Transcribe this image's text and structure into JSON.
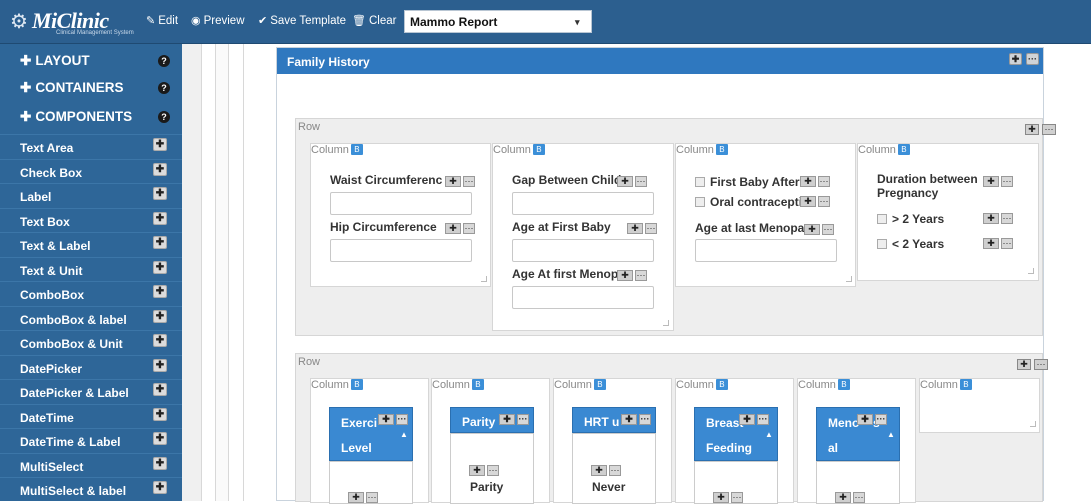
{
  "toolbar": {
    "brand": "MiClinic",
    "tagline": "Clinical Management System",
    "edit_label": "Edit",
    "preview_label": "Preview",
    "save_label": "Save Template",
    "clear_label": "Clear",
    "template_value": "Mammo Report",
    "template_arrow": "▾"
  },
  "sidebar": {
    "sections": [
      {
        "label": "LAYOUT",
        "help": "?"
      },
      {
        "label": "CONTAINERS",
        "help": "?"
      },
      {
        "label": "COMPONENTS",
        "help": "?"
      }
    ],
    "items": [
      "Text Area",
      "Check Box",
      "Label",
      "Text Box",
      "Text & Label",
      "Text & Unit",
      "ComboBox",
      "ComboBox & label",
      "ComboBox & Unit",
      "DatePicker",
      "DatePicker & Label",
      "DateTime",
      "DateTime & Label",
      "MultiSelect",
      "MultiSelect & label"
    ]
  },
  "panel": {
    "title": "Family History"
  },
  "row_label": "Row",
  "column_label": "Column",
  "row1": {
    "col1": {
      "f1": "Waist Circumferenc",
      "f2": "Hip Circumference"
    },
    "col2": {
      "f1": "Gap Between Child",
      "f2": "Age at First Baby",
      "f3": "Age At first Menopa"
    },
    "col3": {
      "c1": "First Baby After A",
      "c2": "Oral contraceptiv",
      "f1": "Age at last Menopa"
    },
    "col4": {
      "f1a": "Duration between",
      "f1b": "Pregnancy",
      "c1": "> 2 Years",
      "c2": "< 2 Years"
    }
  },
  "row2": {
    "b1": {
      "a": "Exerci",
      "b": "Level"
    },
    "b2": {
      "a": "Parity",
      "lbl": "Parity"
    },
    "b3": {
      "a": "HRT u",
      "lbl": "Never"
    },
    "b4": {
      "a": "Breast",
      "b": "Feeding"
    },
    "b5": {
      "a": "Meno",
      "a2": "s",
      "b": "al"
    }
  },
  "colors": {
    "topbar": "#2c5f8f",
    "sidebar": "#2e6698",
    "panel_head": "#2f78bf",
    "box": "#3a89d2"
  }
}
